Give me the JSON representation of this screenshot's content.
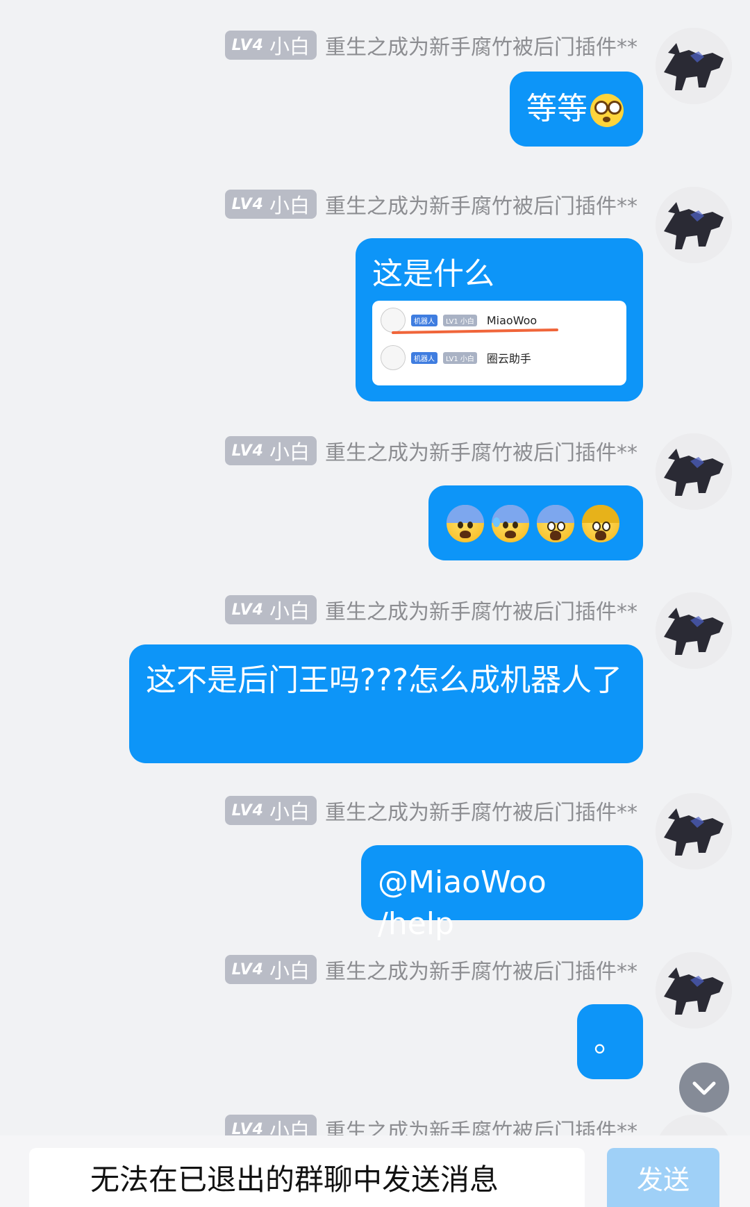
{
  "sender": {
    "level_prefix": "LV4",
    "level_title": "小白",
    "name": "重生之成为新手腐竹被后门插件**"
  },
  "messages": [
    {
      "text": "等等",
      "emoji": "flushed-face"
    },
    {
      "text": "这是什么",
      "attachment": {
        "rows": [
          {
            "bot_tag": "机器人",
            "level_tag": "LV1 小白",
            "name": "MiaoWoo"
          },
          {
            "bot_tag": "机器人",
            "level_tag": "LV1 小白",
            "name": "圈云助手"
          }
        ]
      }
    },
    {
      "emoji_sequence": [
        "fearful-face",
        "anxious-sweat-face",
        "scream-face",
        "scream-face"
      ]
    },
    {
      "text": "这不是后门王吗???怎么成机器人了"
    },
    {
      "text": "@MiaoWoo /help"
    },
    {
      "text": "。"
    }
  ],
  "composer": {
    "placeholder": "无法在已退出的群聊中发送消息",
    "send_label": "发送"
  },
  "colors": {
    "background": "#f1f2f4",
    "bubble": "#0d95f8",
    "level_badge": "#b9bcc6",
    "send_disabled": "#9fd0f7"
  }
}
